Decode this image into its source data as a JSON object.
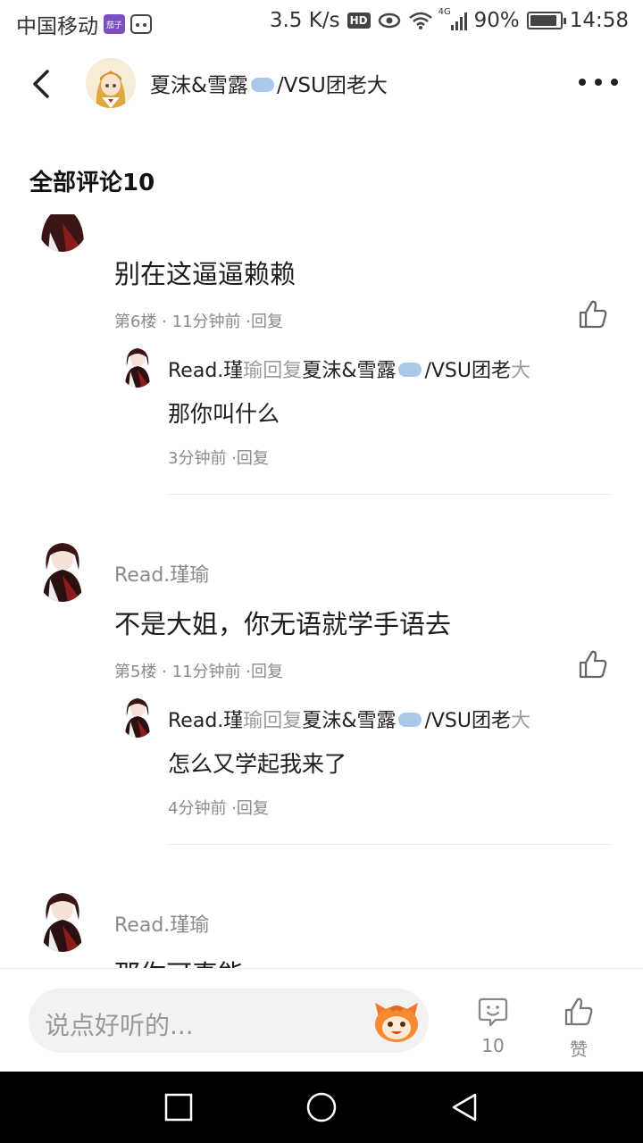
{
  "status_bar": {
    "carrier": "中国移动",
    "app_badge": "茄子",
    "speed": "3.5 K/s",
    "hd": "HD",
    "network": "4G",
    "battery_percent": "90%",
    "battery_level": 0.9,
    "time": "14:58"
  },
  "header": {
    "back_icon": "back-arrow-icon",
    "title": "夏沫&雪露",
    "title_suffix": "/VSU团老大",
    "more_icon": "more-icon"
  },
  "section": {
    "title": "全部评论10"
  },
  "comments": [
    {
      "author": "",
      "text": "别在这逼逼赖赖",
      "meta": "第6楼 · 11分钟前 ·回复",
      "reply": {
        "author": "Read.瑾",
        "author_tail": "瑜",
        "reply_word": "回复",
        "target": "夏沫&雪露",
        "target_suffix": "/VSU团老",
        "target_tail": "大",
        "text": "那你叫什么",
        "meta": "3分钟前 ·回复"
      }
    },
    {
      "author": "Read.瑾瑜",
      "text": "不是大姐，你无语就学手语去",
      "meta": "第5楼 · 11分钟前 ·回复",
      "reply": {
        "author": "Read.瑾",
        "author_tail": "瑜",
        "reply_word": "回复",
        "target": "夏沫&雪露",
        "target_suffix": "/VSU团老",
        "target_tail": "大",
        "text": "怎么又学起我来了",
        "meta": "4分钟前 ·回复"
      }
    },
    {
      "author": "Read.瑾瑜",
      "text": "那你可真能"
    }
  ],
  "bottom_bar": {
    "placeholder": "说点好听的...",
    "comment_count": "10",
    "like_label": "赞"
  },
  "colors": {
    "accent_gray": "#8a8a8a",
    "cloud": "#a9c9ea",
    "nav_bg": "#000000"
  }
}
